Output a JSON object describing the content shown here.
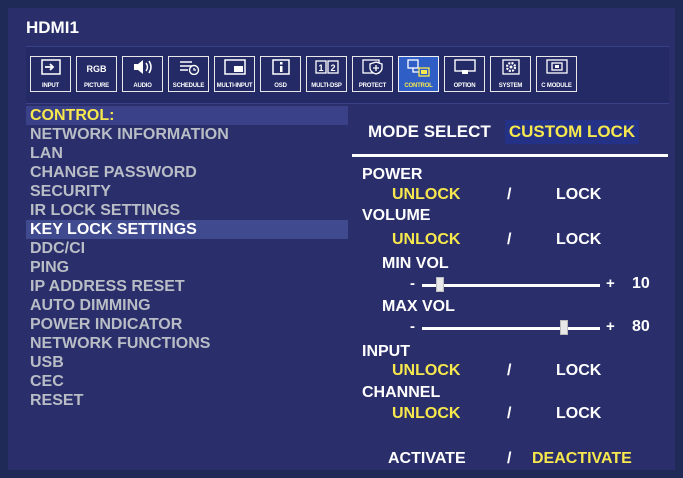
{
  "title": "HDMI1",
  "icon_bar": [
    {
      "name": "input",
      "label": "INPUT",
      "glyph": "➡"
    },
    {
      "name": "picture",
      "label": "PICTURE",
      "glyph": "RGB"
    },
    {
      "name": "audio",
      "label": "AUDIO",
      "glyph": "🔊"
    },
    {
      "name": "schedule",
      "label": "SCHEDULE",
      "glyph": "☰"
    },
    {
      "name": "multi-input",
      "label": "MULTI-INPUT",
      "glyph": "▭"
    },
    {
      "name": "osd",
      "label": "OSD",
      "glyph": "i"
    },
    {
      "name": "multi-dsp",
      "label": "MULTI-DSP",
      "glyph": "12"
    },
    {
      "name": "protect",
      "label": "PROTECT",
      "glyph": "⛨"
    },
    {
      "name": "control",
      "label": "CONTROL",
      "glyph": "⧉",
      "selected": true
    },
    {
      "name": "option",
      "label": "OPTION",
      "glyph": "▭"
    },
    {
      "name": "system",
      "label": "SYSTEM",
      "glyph": "⚙"
    },
    {
      "name": "c-module",
      "label": "C MODULE",
      "glyph": "▣"
    }
  ],
  "menu": {
    "items": [
      "CONTROL:",
      "NETWORK INFORMATION",
      "LAN",
      "CHANGE PASSWORD",
      "SECURITY",
      "IR LOCK SETTINGS",
      "KEY LOCK SETTINGS",
      "DDC/CI",
      "PING",
      "IP ADDRESS RESET",
      "AUTO DIMMING",
      "POWER INDICATOR",
      "NETWORK FUNCTIONS",
      "USB",
      "CEC",
      "RESET"
    ]
  },
  "panel": {
    "mode_label": "MODE SELECT",
    "mode_value": "CUSTOM LOCK",
    "power": {
      "label": "POWER",
      "unlock": "UNLOCK",
      "sep": "/",
      "lock": "LOCK"
    },
    "volume": {
      "label": "VOLUME",
      "unlock": "UNLOCK",
      "sep": "/",
      "lock": "LOCK"
    },
    "min_vol": {
      "label": "MIN VOL",
      "minus": "-",
      "plus": "+",
      "value": "10",
      "level": 10
    },
    "max_vol": {
      "label": "MAX VOL",
      "minus": "-",
      "plus": "+",
      "value": "80",
      "level": 80
    },
    "input": {
      "label": "INPUT",
      "unlock": "UNLOCK",
      "sep": "/",
      "lock": "LOCK"
    },
    "channel": {
      "label": "CHANNEL",
      "unlock": "UNLOCK",
      "sep": "/",
      "lock": "LOCK"
    },
    "activate": "ACTIVATE",
    "act_sep": "/",
    "deactivate": "DEACTIVATE"
  }
}
